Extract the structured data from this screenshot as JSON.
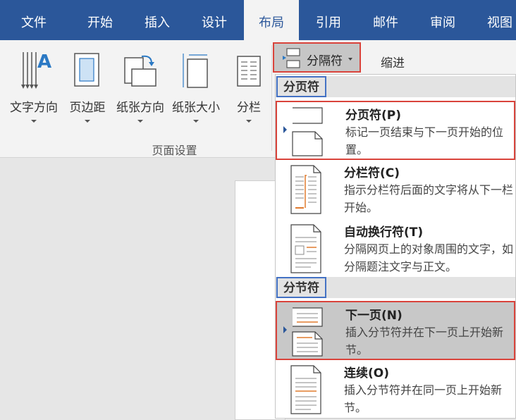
{
  "tabs": [
    "文件",
    "开始",
    "插入",
    "设计",
    "布局",
    "引用",
    "邮件",
    "审阅",
    "视图"
  ],
  "active_tab": "布局",
  "ribbon": {
    "buttons": [
      "文字方向",
      "页边距",
      "纸张方向",
      "纸张大小",
      "分栏"
    ],
    "group_label": "页面设置",
    "breaks_label": "分隔符",
    "indent_label": "缩进"
  },
  "menu": {
    "page_breaks_header": "分页符",
    "section_breaks_header": "分节符",
    "items": [
      {
        "title": "分页符(P)",
        "desc": "标记一页结束与下一页开始的位置。"
      },
      {
        "title": "分栏符(C)",
        "desc": "指示分栏符后面的文字将从下一栏开始。"
      },
      {
        "title": "自动换行符(T)",
        "desc": "分隔网页上的对象周围的文字，如分隔题注文字与正文。"
      },
      {
        "title": "下一页(N)",
        "desc": "插入分节符并在下一页上开始新节。"
      },
      {
        "title": "连续(O)",
        "desc": "插入分节符并在同一页上开始新节。"
      }
    ]
  },
  "colors": {
    "accent": "#2b579a",
    "highlight_red": "#d9433b",
    "header_blue": "#4472c4",
    "page_break_orange": "#e07b2f"
  }
}
